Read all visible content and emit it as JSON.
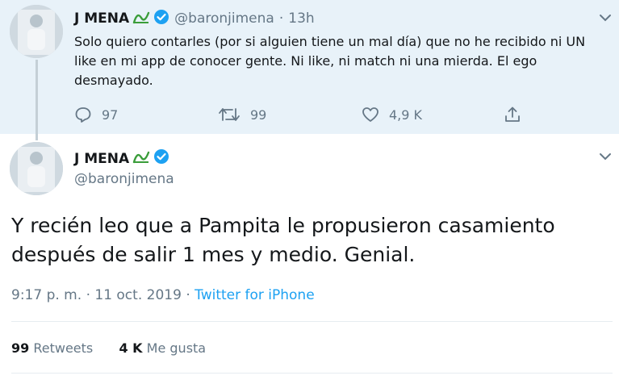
{
  "colors": {
    "accent": "#1da1f2",
    "muted": "#657786",
    "thread_bg": "#e8f2f9",
    "badge_green": "#3a9d3a"
  },
  "tweet1": {
    "display_name": "J MENA",
    "handle": "@baronjimena",
    "separator": "·",
    "time": "13h",
    "text": "Solo quiero contarles (por si alguien tiene un mal día) que no he recibido ni UN like en mi app de conocer gente. Ni like, ni match ni una mierda. El ego desmayado.",
    "replies": "97",
    "retweets": "99",
    "likes": "4,9 K",
    "icons": [
      "reply-icon",
      "retweet-icon",
      "like-icon",
      "share-icon",
      "chevron-down-icon",
      "verified-icon"
    ]
  },
  "tweet2": {
    "display_name": "J MENA",
    "handle": "@baronjimena",
    "text": "Y recién leo que a Pampita le propusieron casamiento después de salir 1 mes y medio. Genial.",
    "time": "9:17 p. m.",
    "date_sep": "·",
    "date": "11 oct. 2019",
    "source_sep": "·",
    "source": "Twitter for iPhone",
    "retweets_count": "99",
    "retweets_label": "Retweets",
    "likes_count": "4 K",
    "likes_label": "Me gusta"
  }
}
